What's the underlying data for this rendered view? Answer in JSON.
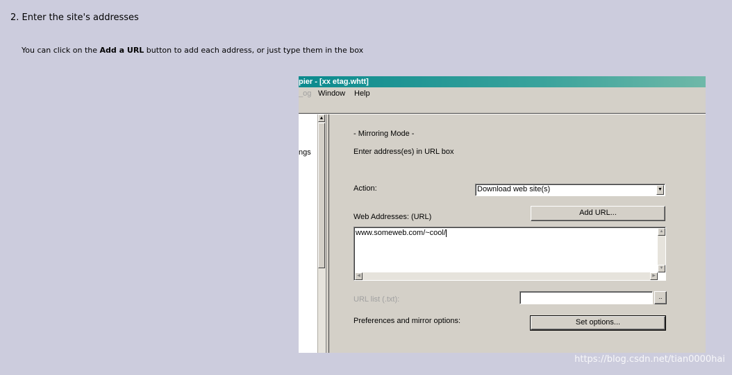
{
  "page": {
    "step_heading": "2. Enter the site's addresses",
    "instruction_before": "You can click on the ",
    "instruction_bold": "Add a URL",
    "instruction_after": " button to add each address, or just type them in the box"
  },
  "window": {
    "title": "pier - [xx etag.whtt]",
    "menu": {
      "log": "_og",
      "window": "Window",
      "help": "Help"
    },
    "left_pane_text": "ngs"
  },
  "form": {
    "mode_label": "- Mirroring Mode -",
    "hint_label": "Enter address(es) in URL box",
    "action_label": "Action:",
    "action_value": "Download web site(s)",
    "web_addresses_label": "Web Addresses: (URL)",
    "add_url_button": "Add URL...",
    "url_value": "www.someweb.com/~cool/",
    "url_list_label": "URL list (.txt):",
    "url_list_value": "",
    "browse_button": "..",
    "preferences_label": "Preferences and mirror options:",
    "set_options_button": "Set options..."
  },
  "watermark": "https://blog.csdn.net/tian0000hai",
  "colors": {
    "page_background": "#ccccdd",
    "window_face": "#d4d0c8",
    "titlebar_start": "#0b8a8e",
    "titlebar_end": "#6fb8a8",
    "disabled_text": "#a0a0a0"
  },
  "icons": {
    "dropdown": "triangle-down",
    "scroll_up": "triangle-up",
    "scroll_down": "triangle-down",
    "scroll_left": "triangle-left",
    "scroll_right": "triangle-right"
  }
}
